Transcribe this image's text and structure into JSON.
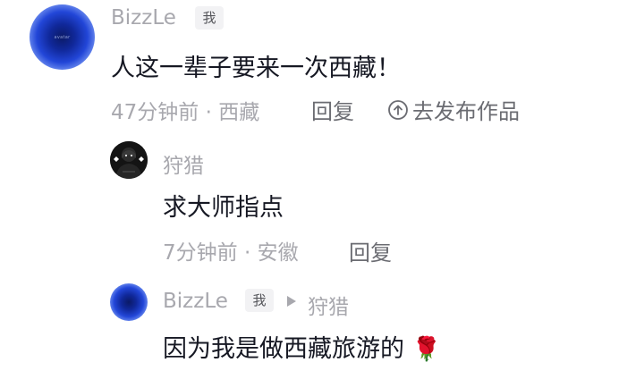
{
  "thread": {
    "top_comment": {
      "avatar_label": "avatar",
      "username": "BizzLe",
      "author_badge": "我",
      "text": "人这一辈子要来一次西藏！",
      "time": "47分钟前",
      "separator": " · ",
      "location": "西藏",
      "reply_label": "回复",
      "publish_label": "去发布作品"
    },
    "reply_1": {
      "username": "狩猎",
      "text": "求大师指点",
      "time": "7分钟前",
      "separator": " · ",
      "location": "安徽",
      "reply_label": "回复"
    },
    "reply_2": {
      "username": "BizzLe",
      "author_badge": "我",
      "reply_to": "狩猎",
      "text": "因为我是做西藏旅游的",
      "emoji": "🌹"
    }
  },
  "colors": {
    "primary_text": "#161823",
    "secondary_text": "#a8a8ae",
    "badge_bg": "#f2f2f4",
    "avatar_blue": "#2246d8"
  }
}
